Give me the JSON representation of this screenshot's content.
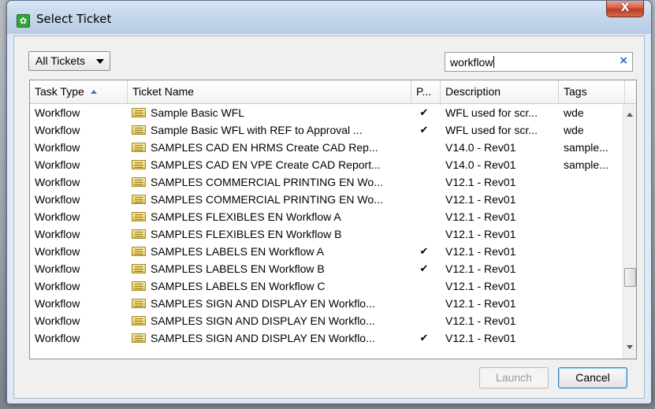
{
  "window": {
    "title": "Select Ticket",
    "close_label": "X"
  },
  "toolbar": {
    "filter_value": "All Tickets",
    "search_value": "workflow",
    "search_clear": "×"
  },
  "table": {
    "headers": {
      "task_type": "Task Type",
      "ticket_name": "Ticket Name",
      "p": "P...",
      "description": "Description",
      "tags": "Tags"
    },
    "sort": {
      "column": "Task Type",
      "direction": "ascending"
    },
    "rows": [
      {
        "task_type": "Workflow",
        "name": "Sample Basic WFL",
        "p": "✔",
        "description": "WFL used for scr...",
        "tags": "wde"
      },
      {
        "task_type": "Workflow",
        "name": "Sample Basic WFL with REF to Approval ...",
        "p": "✔",
        "description": "WFL used for scr...",
        "tags": "wde"
      },
      {
        "task_type": "Workflow",
        "name": "SAMPLES CAD EN HRMS Create CAD Rep...",
        "p": "",
        "description": "V14.0 - Rev01",
        "tags": "sample..."
      },
      {
        "task_type": "Workflow",
        "name": "SAMPLES CAD EN VPE Create CAD Report...",
        "p": "",
        "description": "V14.0 - Rev01",
        "tags": "sample..."
      },
      {
        "task_type": "Workflow",
        "name": "SAMPLES COMMERCIAL PRINTING EN Wo...",
        "p": "",
        "description": "V12.1 - Rev01",
        "tags": ""
      },
      {
        "task_type": "Workflow",
        "name": "SAMPLES COMMERCIAL PRINTING EN Wo...",
        "p": "",
        "description": "V12.1 - Rev01",
        "tags": ""
      },
      {
        "task_type": "Workflow",
        "name": "SAMPLES FLEXIBLES EN Workflow A",
        "p": "",
        "description": "V12.1 - Rev01",
        "tags": ""
      },
      {
        "task_type": "Workflow",
        "name": "SAMPLES FLEXIBLES EN Workflow B",
        "p": "",
        "description": "V12.1 - Rev01",
        "tags": ""
      },
      {
        "task_type": "Workflow",
        "name": "SAMPLES LABELS EN Workflow A",
        "p": "✔",
        "description": "V12.1 - Rev01",
        "tags": ""
      },
      {
        "task_type": "Workflow",
        "name": "SAMPLES LABELS EN Workflow B",
        "p": "✔",
        "description": "V12.1 - Rev01",
        "tags": ""
      },
      {
        "task_type": "Workflow",
        "name": "SAMPLES LABELS EN Workflow C",
        "p": "",
        "description": "V12.1 - Rev01",
        "tags": ""
      },
      {
        "task_type": "Workflow",
        "name": "SAMPLES SIGN AND DISPLAY EN Workflo...",
        "p": "",
        "description": "V12.1 - Rev01",
        "tags": ""
      },
      {
        "task_type": "Workflow",
        "name": "SAMPLES SIGN AND DISPLAY EN Workflo...",
        "p": "",
        "description": "V12.1 - Rev01",
        "tags": ""
      },
      {
        "task_type": "Workflow",
        "name": "SAMPLES SIGN AND DISPLAY EN Workflo...",
        "p": "✔",
        "description": "V12.1 - Rev01",
        "tags": ""
      }
    ]
  },
  "buttons": {
    "launch": "Launch",
    "cancel": "Cancel"
  },
  "icons": {
    "app": "app-gear-icon",
    "ticket": "ticket-icon",
    "sort": "sort-ascending-icon",
    "dropdown": "chevron-down-icon",
    "clear": "clear-search-icon"
  },
  "colors": {
    "titlebar": "#c3d5ea",
    "close_button": "#c03a22",
    "clear_icon": "#2b62c5",
    "sort_arrow": "#4a78b8"
  }
}
